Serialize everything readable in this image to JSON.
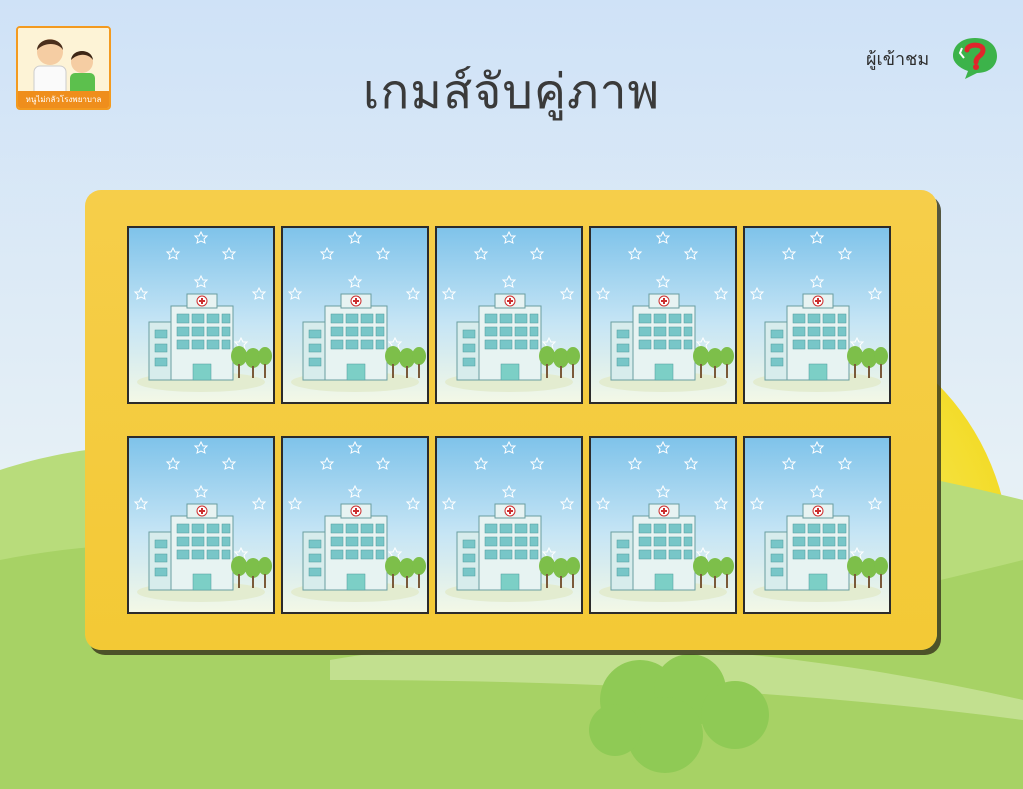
{
  "header": {
    "title": "เกมส์จับคู่ภาพ",
    "logo_caption": "หนูไม่กลัวโรงพยาบาล",
    "visitor_label": "ผู้เข้าชม",
    "help_icon": "question-help-icon"
  },
  "board": {
    "rows": 2,
    "columns": 5,
    "cards": [
      {
        "state": "face-down",
        "back_image": "hospital-card-back"
      },
      {
        "state": "face-down",
        "back_image": "hospital-card-back"
      },
      {
        "state": "face-down",
        "back_image": "hospital-card-back"
      },
      {
        "state": "face-down",
        "back_image": "hospital-card-back"
      },
      {
        "state": "face-down",
        "back_image": "hospital-card-back"
      },
      {
        "state": "face-down",
        "back_image": "hospital-card-back"
      },
      {
        "state": "face-down",
        "back_image": "hospital-card-back"
      },
      {
        "state": "face-down",
        "back_image": "hospital-card-back"
      },
      {
        "state": "face-down",
        "back_image": "hospital-card-back"
      },
      {
        "state": "face-down",
        "back_image": "hospital-card-back"
      }
    ]
  },
  "colors": {
    "board": "#f3c935",
    "sky": "#d6e8f8",
    "grass": "#a9d66b",
    "sun": "#f6e43c",
    "logo_accent": "#ef8e1c",
    "help_green": "#3cb34a",
    "help_red": "#e0262b"
  }
}
